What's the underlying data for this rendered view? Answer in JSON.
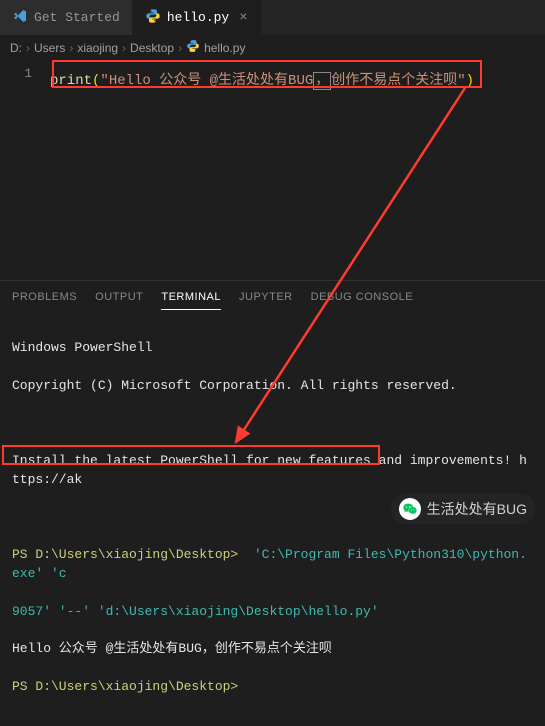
{
  "tabs": {
    "get_started": "Get Started",
    "hello_file": "hello.py"
  },
  "breadcrumb": {
    "parts": [
      "D:",
      "Users",
      "xiaojing",
      "Desktop"
    ],
    "filename": "hello.py"
  },
  "code": {
    "line_number": "1",
    "func": "print",
    "open": "(",
    "str_open": "\"",
    "str_a": "Hello 公众号 @生活处处有BUG",
    "str_cursor": "，",
    "str_b": "创作不易点个关注呗",
    "str_close": "\"",
    "close": ")"
  },
  "panel_tabs": {
    "problems": "PROBLEMS",
    "output": "OUTPUT",
    "terminal": "TERMINAL",
    "jupyter": "JUPYTER",
    "debug": "DEBUG CONSOLE"
  },
  "terminal": {
    "ps_header1": "Windows PowerShell",
    "ps_header2": "Copyright (C) Microsoft Corporation. All rights reserved.",
    "ps_install": "Install the latest PowerShell for new features and improvements! https://ak",
    "prompt1_path": "PS D:\\Users\\xiaojing\\Desktop> ",
    "cmd_line1": " 'C:\\Program Files\\Python310\\python.exe' 'c",
    "cmd_line2": "9057' '--' 'd:\\Users\\xiaojing\\Desktop\\hello.py'",
    "output_line": "Hello 公众号 @生活处处有BUG，创作不易点个关注呗",
    "prompt2_path": "PS D:\\Users\\xiaojing\\Desktop>"
  },
  "watermark": {
    "text": "生活处处有BUG"
  },
  "icons": {
    "chevron": "›",
    "close": "×"
  }
}
